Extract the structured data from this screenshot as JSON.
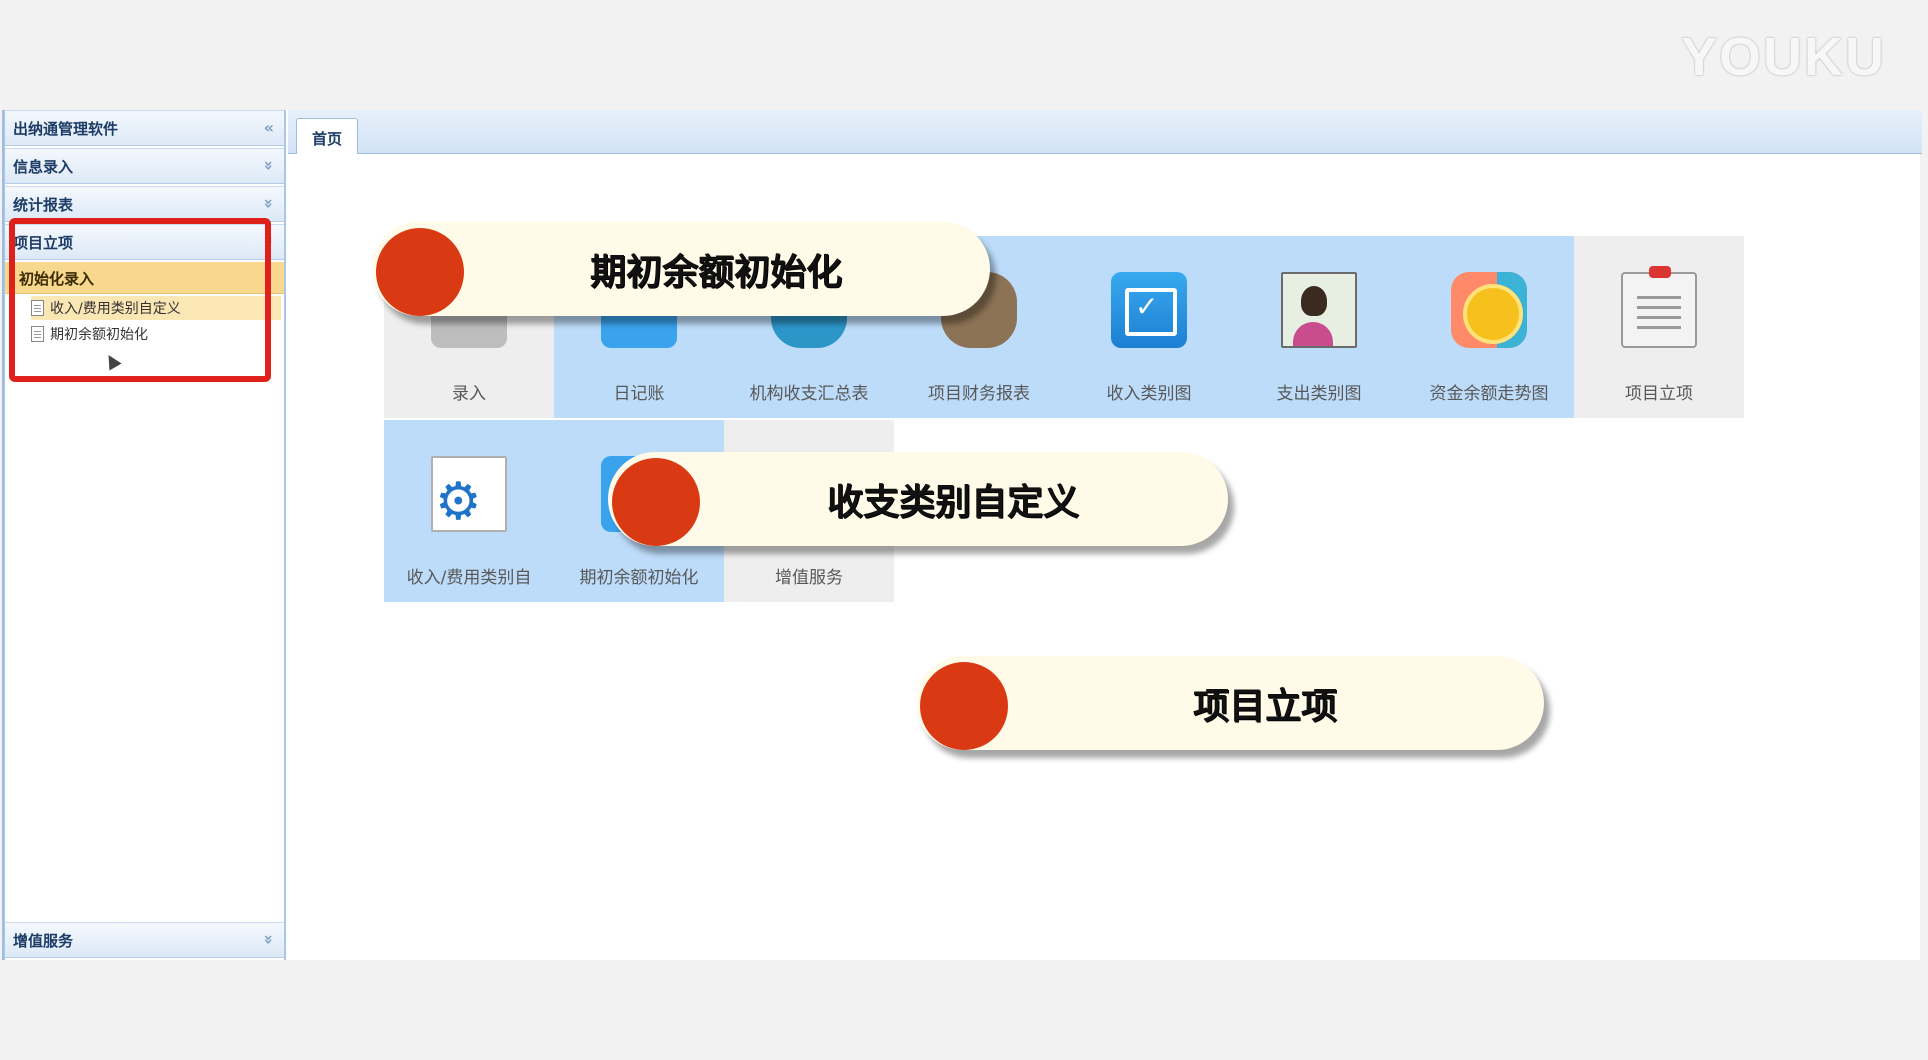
{
  "watermark": "YOUKU",
  "sidebar": {
    "title": "出纳通管理软件",
    "title_chev": "«",
    "panels": [
      {
        "label": "信息录入",
        "chev": "»"
      },
      {
        "label": "统计报表",
        "chev": "»"
      },
      {
        "label": "项目立项",
        "chev": "»"
      }
    ],
    "sub_head": "初始化录入",
    "tree_items": [
      "收入/费用类别自定义",
      "期初余额初始化"
    ],
    "bottom_panel": {
      "label": "增值服务",
      "chev": "»"
    }
  },
  "tabs": [
    {
      "label": "首页"
    }
  ],
  "tiles": [
    {
      "label": "录入",
      "icon": "entry-icon"
    },
    {
      "label": "日记账",
      "icon": "journal-icon"
    },
    {
      "label": "机构收支汇总表",
      "icon": "summary-icon"
    },
    {
      "label": "项目财务报表",
      "icon": "project-report-icon"
    },
    {
      "label": "收入类别图",
      "icon": "edit-check-icon"
    },
    {
      "label": "支出类别图",
      "icon": "person-chart-icon"
    },
    {
      "label": "资金余额走势图",
      "icon": "coin-icon"
    },
    {
      "label": "项目立项",
      "icon": "clipboard-icon"
    },
    {
      "label": "收入/费用类别自",
      "icon": "gear-doc-icon"
    },
    {
      "label": "期初余额初始化",
      "icon": "balance-icon"
    },
    {
      "label": "增值服务",
      "icon": "service-icon"
    }
  ],
  "callouts": [
    "期初余额初始化",
    "收支类别自定义",
    "项目立项"
  ],
  "colors": {
    "accent_red": "#e0201b",
    "callout_dot": "#d93a14",
    "tile_blue": "#bddcfa",
    "selected_yellow": "#f7d88e"
  }
}
